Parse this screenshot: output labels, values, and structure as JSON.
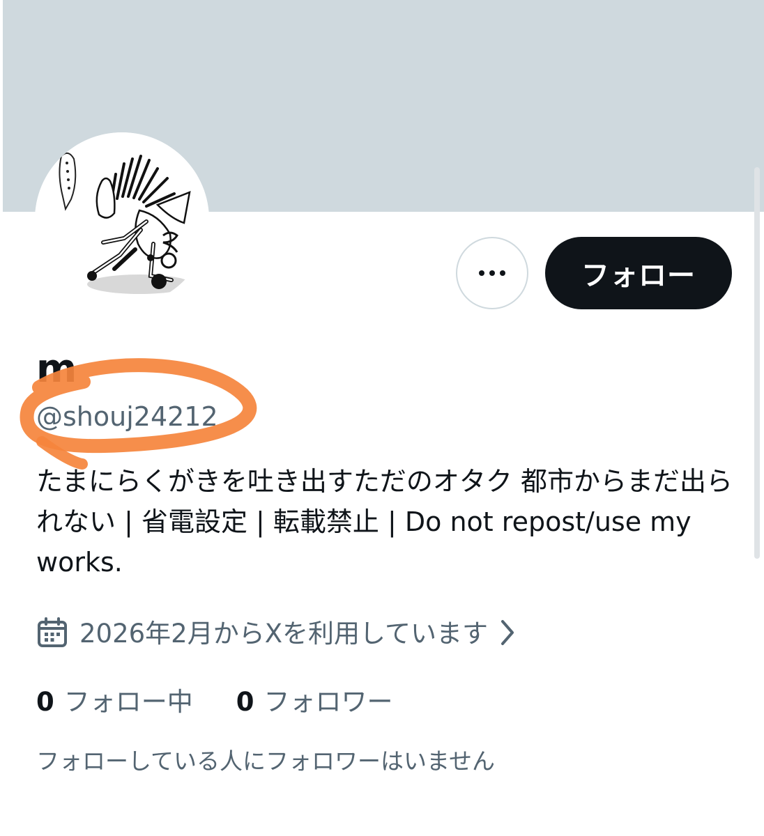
{
  "profile": {
    "display_name": "m",
    "handle": "@shouj24212",
    "bio": "たまにらくがきを吐き出すただのオタク 都市からまだ出られない | 省電設定 | 転載禁止 | Do not repost/use my works.",
    "joined_text": "2026年2月からXを利用しています",
    "following_count": "0",
    "following_label": "フォロー中",
    "followers_count": "0",
    "followers_label": "フォロワー",
    "followers_you_know": "フォローしている人にフォロワーはいません"
  },
  "actions": {
    "more_icon": "more-horizontal-icon",
    "follow_label": "フォロー"
  },
  "icons": {
    "calendar": "calendar-icon",
    "chevron": "chevron-right-icon"
  },
  "colors": {
    "banner": "#cfd9de",
    "primary_text": "#0f1419",
    "secondary_text": "#536471",
    "follow_button_bg": "#0f1419",
    "highlight": "#f5843c"
  }
}
